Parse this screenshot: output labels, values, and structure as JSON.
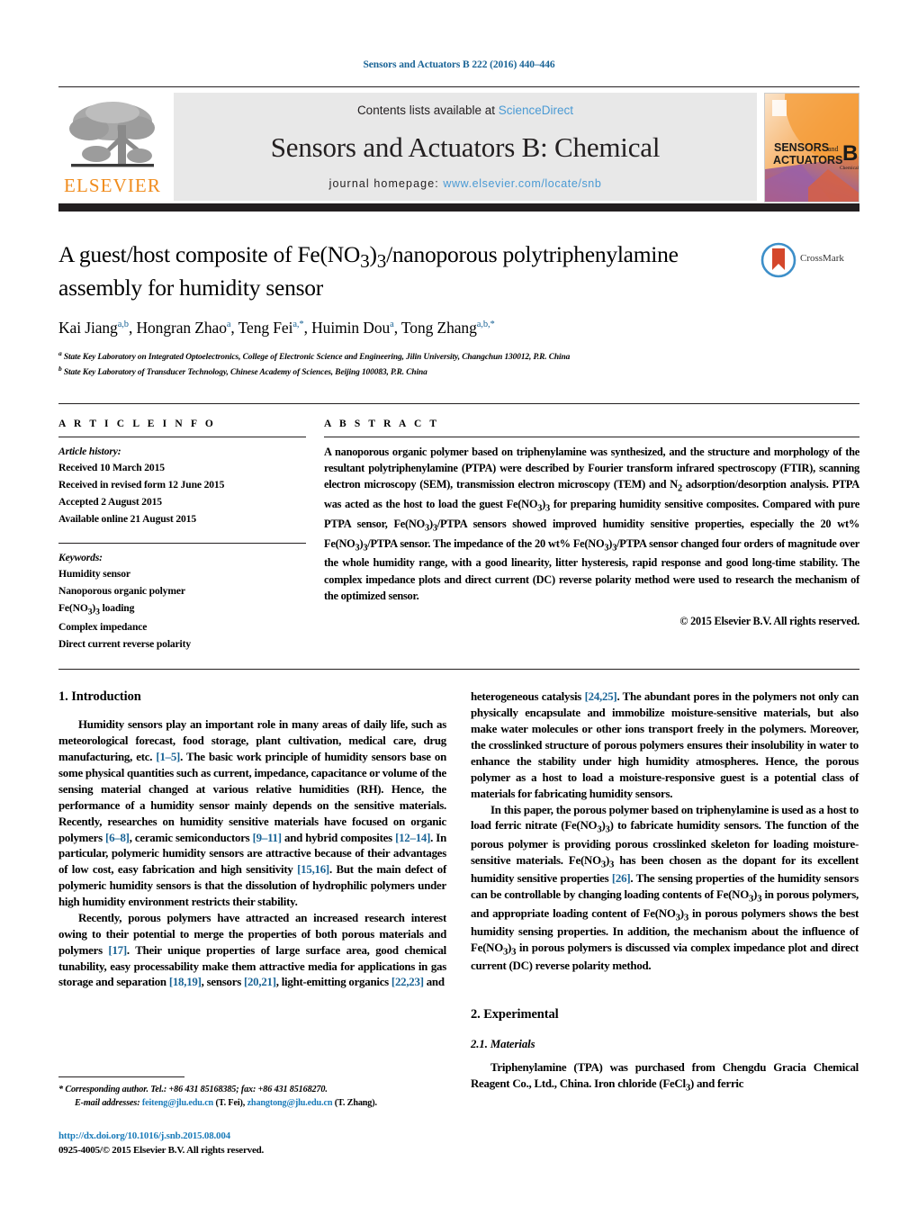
{
  "running_head": "Sensors and Actuators B 222 (2016) 440–446",
  "masthead": {
    "publisher_name": "ELSEVIER",
    "contents_prefix": "Contents lists available at ",
    "contents_link": "ScienceDirect",
    "journal_title": "Sensors and Actuators B: Chemical",
    "homepage_prefix": "journal homepage: ",
    "homepage_url": "www.elsevier.com/locate/snb",
    "cover_line1": "SENSORS",
    "cover_and": "and",
    "cover_line2": "ACTUATORS",
    "cover_letter": "B",
    "cover_sub": "Chemical"
  },
  "article": {
    "title": "A guest/host composite of Fe(NO3)3/nanoporous polytriphenylamine assembly for humidity sensor",
    "title_html": "A guest/host composite of Fe(NO<sub>3</sub>)<sub>3</sub>/nanoporous polytriphenylamine assembly for humidity sensor",
    "authors_html": "Kai Jiang<sup>a,b</sup>, Hongran Zhao<sup>a</sup>, Teng Fei<sup>a,*</sup>, Huimin Dou<sup>a</sup>, Tong Zhang<sup>a,b,*</sup>",
    "affiliations": [
      "a State Key Laboratory on Integrated Optoelectronics, College of Electronic Science and Engineering, Jilin University, Changchun 130012, P.R. China",
      "b State Key Laboratory of Transducer Technology, Chinese Academy of Sciences, Beijing 100083, P.R. China"
    ],
    "crossmark_label": "CrossMark"
  },
  "article_info": {
    "heading": "A R T I C L E  I N F O",
    "history_head": "Article history:",
    "history": [
      "Received 10 March 2015",
      "Received in revised form 12 June 2015",
      "Accepted 2 August 2015",
      "Available online 21 August 2015"
    ],
    "keywords_head": "Keywords:",
    "keywords": [
      "Humidity sensor",
      "Nanoporous organic polymer",
      "Fe(NO3)3 loading",
      "Complex impedance",
      "Direct current reverse polarity"
    ]
  },
  "abstract": {
    "heading": "A B S T R A C T",
    "body_html": "A nanoporous organic polymer based on triphenylamine was synthesized, and the structure and morphology of the resultant polytriphenylamine (PTPA) were described by Fourier transform infrared spectroscopy (FTIR), scanning electron microscopy (SEM), transmission electron microscopy (TEM) and N<sub>2</sub> adsorption/desorption analysis. PTPA was acted as the host to load the guest Fe(NO<sub>3</sub>)<sub>3</sub> for preparing humidity sensitive composites. Compared with pure PTPA sensor, Fe(NO<sub>3</sub>)<sub>3</sub>/PTPA sensors showed improved humidity sensitive properties, especially the 20 wt% Fe(NO<sub>3</sub>)<sub>3</sub>/PTPA sensor. The impedance of the 20 wt% Fe(NO<sub>3</sub>)<sub>3</sub>/PTPA sensor changed four orders of magnitude over the whole humidity range, with a good linearity, litter hysteresis, rapid response and good long-time stability. The complex impedance plots and direct current (DC) reverse polarity method were used to research the mechanism of the optimized sensor.",
    "copyright": "© 2015 Elsevier B.V. All rights reserved."
  },
  "sections": {
    "intro_heading": "1.  Introduction",
    "intro_p1_html": "Humidity sensors play an important role in many areas of daily life, such as meteorological forecast, food storage, plant cultivation, medical care, drug manufacturing, etc. <span class=\"ref\">[1–5]</span>. The basic work principle of humidity sensors base on some physical quantities such as current, impedance, capacitance or volume of the sensing material changed at various relative humidities (RH). Hence, the performance of a humidity sensor mainly depends on the sensitive materials. Recently, researches on humidity sensitive materials have focused on organic polymers <span class=\"ref\">[6–8]</span>, ceramic semiconductors <span class=\"ref\">[9–11]</span> and hybrid composites <span class=\"ref\">[12–14]</span>. In particular, polymeric humidity sensors are attractive because of their advantages of low cost, easy fabrication and high sensitivity <span class=\"ref\">[15,16]</span>. But the main defect of polymeric humidity sensors is that the dissolution of hydrophilic polymers under high humidity environment restricts their stability.",
    "intro_p2_html": "Recently, porous polymers have attracted an increased research interest owing to their potential to merge the properties of both porous materials and polymers <span class=\"ref\">[17]</span>. Their unique properties of large surface area, good chemical tunability, easy processability make them attractive media for applications in gas storage and separation <span class=\"ref\">[18,19]</span>, sensors <span class=\"ref\">[20,21]</span>, light-emitting organics <span class=\"ref\">[22,23]</span> and",
    "intro_p2_cont_html": "heterogeneous catalysis <span class=\"ref\">[24,25]</span>. The abundant pores in the polymers not only can physically encapsulate and immobilize moisture-sensitive materials, but also make water molecules or other ions transport freely in the polymers. Moreover, the crosslinked structure of porous polymers ensures their insolubility in water to enhance the stability under high humidity atmospheres. Hence, the porous polymer as a host to load a moisture-responsive guest is a potential class of materials for fabricating humidity sensors.",
    "intro_p3_html": "In this paper, the porous polymer based on triphenylamine is used as a host to load ferric nitrate (Fe(NO<sub>3</sub>)<sub>3</sub>) to fabricate humidity sensors. The function of the porous polymer is providing porous crosslinked skeleton for loading moisture-sensitive materials. Fe(NO<sub>3</sub>)<sub>3</sub> has been chosen as the dopant for its excellent humidity sensitive properties <span class=\"ref\">[26]</span>. The sensing properties of the humidity sensors can be controllable by changing loading contents of Fe(NO<sub>3</sub>)<sub>3</sub> in porous polymers, and appropriate loading content of Fe(NO<sub>3</sub>)<sub>3</sub> in porous polymers shows the best humidity sensing properties. In addition, the mechanism about the influence of Fe(NO<sub>3</sub>)<sub>3</sub> in porous polymers is discussed via complex impedance plot and direct current (DC) reverse polarity method.",
    "experimental_heading": "2.  Experimental",
    "materials_heading": "2.1.  Materials",
    "materials_p1_html": "Triphenylamine (TPA) was purchased from Chengdu Gracia Chemical Reagent Co., Ltd., China. Iron chloride (FeCl<sub>3</sub>) and ferric"
  },
  "footer": {
    "corresponding_html": "<span class=\"em\">*  Corresponding author. Tel.: +86 431 85168385; fax: +86 431 85168270.</span>",
    "emails_html": "<span class=\"em\">E-mail addresses:</span> <span class=\"link\">feiteng@jlu.edu.cn</span> (T. Fei), <span class=\"link\">zhangtong@jlu.edu.cn</span> (T. Zhang).",
    "doi_html": "<span class=\"doi-link\">http://dx.doi.org/10.1016/j.snb.2015.08.004</span>",
    "issn_line": "0925-4005/© 2015 Elsevier B.V. All rights reserved."
  },
  "colors": {
    "link": "#1a7bb9",
    "ref": "#1a6496",
    "elsevier_orange": "#f08c1d",
    "dark_rule": "#231f20",
    "journal_band": "#e8e8e8"
  }
}
